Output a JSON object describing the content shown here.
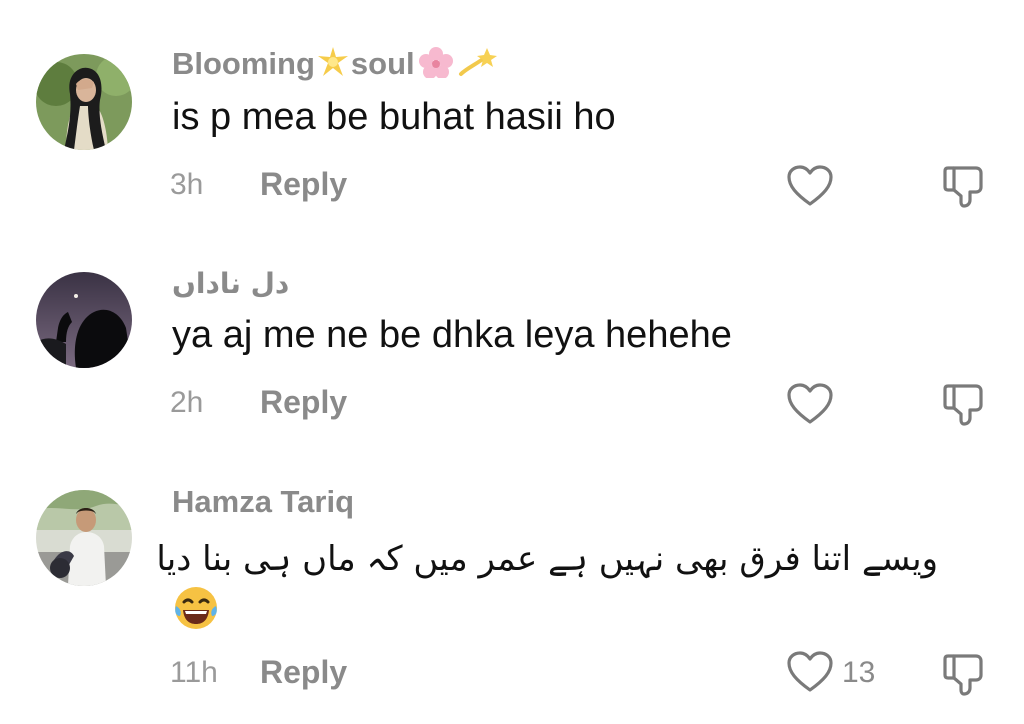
{
  "comments": [
    {
      "username": "Blooming",
      "username_part2": "soul",
      "text": "is p mea be buhat hasii ho",
      "time": "3h",
      "reply_label": "Reply",
      "like_count": ""
    },
    {
      "username": "دل ناداں",
      "text": "ya aj me ne be dhka leya hehehe",
      "time": "2h",
      "reply_label": "Reply",
      "like_count": ""
    },
    {
      "username": "Hamza Tariq",
      "text": "ویسے اتنا فرق بھی نہیں ہے عمر میں کہ ماں ہی بنا دیا",
      "emoji": "😂",
      "time": "11h",
      "reply_label": "Reply",
      "like_count": "13"
    }
  ]
}
